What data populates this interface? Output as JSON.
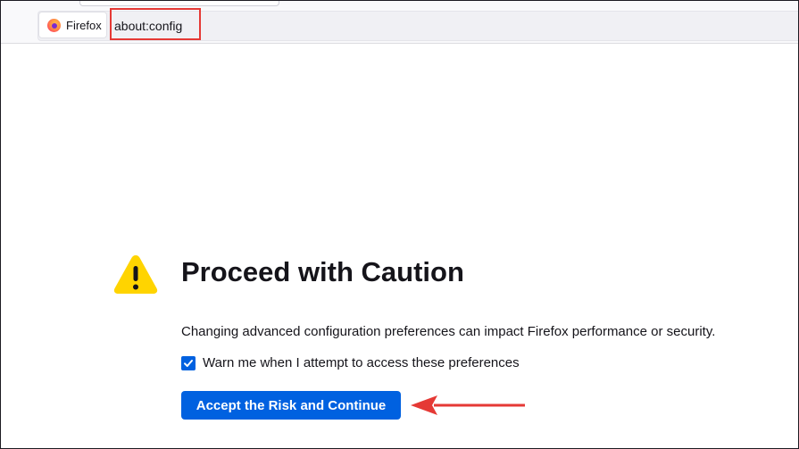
{
  "browser": {
    "identity_label": "Firefox",
    "url": "about:config",
    "accent_color": "#0061e0",
    "highlight_color": "#e53935"
  },
  "warning": {
    "icon": "warning-triangle-icon",
    "icon_color": "#ffd400",
    "title": "Proceed with Caution",
    "description": "Changing advanced configuration preferences can impact Firefox performance or security.",
    "checkbox_label": "Warn me when I attempt to access these preferences",
    "checkbox_checked": true,
    "accept_button_label": "Accept the Risk and Continue"
  },
  "annotations": {
    "arrow_icon": "red-arrow-left-icon",
    "arrow_color": "#e53935"
  }
}
